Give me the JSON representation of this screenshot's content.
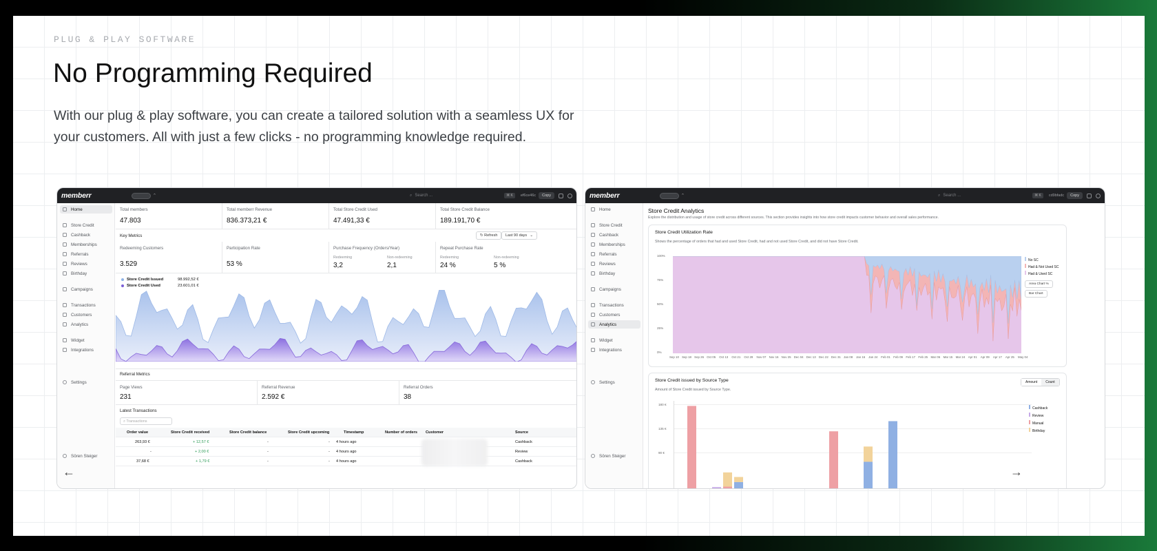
{
  "hero": {
    "eyebrow": "PLUG & PLAY SOFTWARE",
    "title": "No Programming Required",
    "description": "With our plug & play software, you can create a tailored solution with a seamless UX for your customers. All with just a few clicks - no programming knowledge required."
  },
  "app": {
    "logo": "memberr",
    "search_placeholder": "Search ...",
    "kbd": "⌘ K",
    "copy": "Copy",
    "id1": "ef6ce46c",
    "id2": "cd9bfadc",
    "user": "Sören Steiger"
  },
  "sidebar": {
    "items": [
      {
        "label": "Home"
      },
      {
        "label": "Store Credit"
      },
      {
        "label": "Cashback"
      },
      {
        "label": "Memberships"
      },
      {
        "label": "Referrals"
      },
      {
        "label": "Reviews"
      },
      {
        "label": "Birthday"
      },
      {
        "label": "Campaigns"
      },
      {
        "label": "Transactions"
      },
      {
        "label": "Customers"
      },
      {
        "label": "Analytics"
      },
      {
        "label": "Widget"
      },
      {
        "label": "Integrations"
      },
      {
        "label": "Settings"
      }
    ]
  },
  "dashboard": {
    "kpis": [
      {
        "label": "Total members",
        "value": "47.803"
      },
      {
        "label": "Total memberr Revenue",
        "value": "836.373,21 €"
      },
      {
        "label": "Total Store Credit Used",
        "value": "47.491,33 €"
      },
      {
        "label": "Total Store Credit Balance",
        "value": "189.191,70 €"
      }
    ],
    "key_metrics": "Key Metrics",
    "refresh": "Refresh",
    "range": "Last 90 days",
    "metrics": [
      {
        "label": "Redeeming Customers",
        "value": "3.529"
      },
      {
        "label": "Participation Rate",
        "value": "53 %"
      }
    ],
    "freq": {
      "label": "Purchase Frequency (Orders/Year)",
      "a_label": "Redeeming",
      "a": "3,2",
      "b_label": "Non-redeeming",
      "b": "2,1"
    },
    "repeat": {
      "label": "Repeat Purchase Rate",
      "a_label": "Redeeming",
      "a": "24 %",
      "b_label": "Non-redeeming",
      "b": "5 %"
    },
    "legend": [
      {
        "name": "Store Credit Issued",
        "value": "98.992,52 €",
        "color": "#8fb3e6"
      },
      {
        "name": "Store Credit Used",
        "value": "23.601,01 €",
        "color": "#7b5fd6"
      }
    ],
    "referral": {
      "title": "Referral Metrics",
      "items": [
        {
          "label": "Page Views",
          "value": "231"
        },
        {
          "label": "Referral Revenue",
          "value": "2.592 €"
        },
        {
          "label": "Referral Orders",
          "value": "38"
        }
      ]
    },
    "latest": "Latest Transactions",
    "tx_search": "Transactions",
    "columns": [
      "Order value",
      "Store Credit received",
      "Store Credit balance",
      "Store Credit upcoming",
      "Timestamp",
      "Number of orders",
      "Customer",
      "Source"
    ],
    "rows": [
      {
        "order": "263,93 €",
        "received": "+ 12,57 €",
        "balance": "-",
        "upcoming": "-",
        "time": "4 hours ago",
        "source": "Cashback"
      },
      {
        "order": "-",
        "received": "+ 2,00 €",
        "balance": "-",
        "upcoming": "-",
        "time": "4 hours ago",
        "source": "Review"
      },
      {
        "order": "37,68 €",
        "received": "+ 1,79 €",
        "balance": "-",
        "upcoming": "-",
        "time": "4 hours ago",
        "source": "Cashback"
      }
    ]
  },
  "analytics": {
    "title": "Store Credit Analytics",
    "subtitle": "Explore the distribution and usage of store credit across different sources. This section provides insights into how store credit impacts customer behavior and overall sales performance.",
    "util": {
      "title": "Store Credit Utilization Rate",
      "desc": "Shows the percentage of orders that had and used Store Credit, had and not used Store Credit, and did not have Store Credit.",
      "legend": [
        {
          "name": "No SC",
          "color": "#b9d0ef"
        },
        {
          "name": "Had & Not Used SC",
          "color": "#f3b5b5"
        },
        {
          "name": "Had & Used SC",
          "color": "#e6c6ea"
        }
      ],
      "btn1": "Area Chart %",
      "btn2": "Bar Chart",
      "yticks": [
        "100%",
        "75%",
        "50%",
        "25%",
        "0%"
      ],
      "xticks": [
        "Sep 10",
        "Sep 18",
        "Sep 26",
        "Oct 05",
        "Oct 13",
        "Oct 21",
        "Oct 29",
        "Nov 07",
        "Nov 16",
        "Nov 25",
        "Dec 04",
        "Dec 13",
        "Dec 22",
        "Dec 31",
        "Jan 08",
        "Jan 16",
        "Jan 24",
        "Feb 01",
        "Feb 09",
        "Feb 17",
        "Feb 25",
        "Mar 06",
        "Mar 15",
        "Mar 24",
        "Apr 01",
        "Apr 09",
        "Apr 17",
        "Apr 25",
        "May 04"
      ]
    },
    "source": {
      "title": "Store Credit issued by Source Type",
      "desc": "Amount of Store Credit issued by Source Type.",
      "toggle1": "Amount",
      "toggle2": "Count",
      "yticks": [
        "180 €",
        "135 €",
        "90 €"
      ],
      "legend": [
        {
          "name": "Cashback",
          "color": "#8fb0e3"
        },
        {
          "name": "Review",
          "color": "#c6a9e8"
        },
        {
          "name": "Manual",
          "color": "#eea0a4"
        },
        {
          "name": "Birthday",
          "color": "#f2d39b"
        }
      ]
    }
  },
  "chart_data": [
    {
      "type": "area",
      "title": "",
      "series": [
        {
          "name": "Store Credit Issued"
        },
        {
          "name": "Store Credit Used"
        }
      ]
    },
    {
      "type": "area",
      "title": "Store Credit Utilization Rate",
      "ylim": [
        0,
        100
      ],
      "series": [
        {
          "name": "No SC"
        },
        {
          "name": "Had & Not Used SC"
        },
        {
          "name": "Had & Used SC"
        }
      ]
    },
    {
      "type": "bar",
      "title": "Store Credit issued by Source Type",
      "series": [
        {
          "name": "Manual",
          "values": [
            180,
            0,
            0,
            0,
            0,
            0,
            0,
            0,
            0,
            0,
            0,
            0,
            0,
            0,
            0,
            0,
            0,
            0,
            0,
            0,
            0,
            0,
            0,
            0,
            0,
            0,
            0,
            0,
            0,
            0,
            0,
            0,
            0,
            0,
            0,
            0,
            0,
            0,
            0,
            0,
            0,
            0,
            0,
            0,
            0,
            0,
            0,
            0,
            0,
            0,
            0,
            0,
            0,
            0,
            0,
            0,
            0,
            0,
            0,
            0,
            0,
            0,
            0,
            0,
            0,
            0,
            0,
            0,
            0,
            0,
            0,
            0,
            0,
            0,
            0,
            0
          ]
        },
        {
          "name": "Cashback",
          "values": [
            0,
            0,
            28,
            22,
            38,
            22,
            16,
            16
          ]
        },
        {
          "name": "Birthday",
          "values": [
            0,
            3,
            0,
            0,
            0,
            0,
            0,
            0
          ]
        }
      ]
    }
  ]
}
